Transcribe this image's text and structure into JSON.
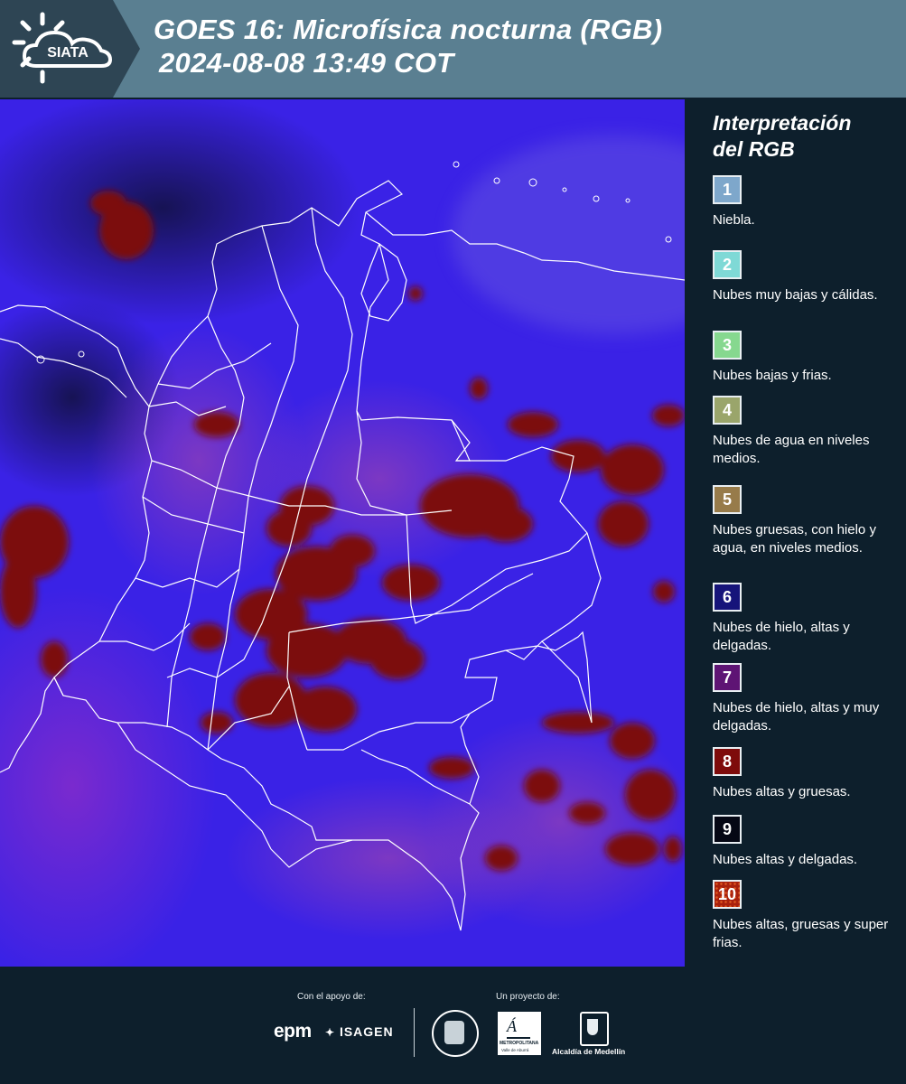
{
  "header": {
    "logo_text": "SIATA",
    "title_line1": "GOES 16: Microfísica nocturna (RGB)",
    "title_line2": "2024-08-08 13:49 COT"
  },
  "legend": {
    "title_line1": "Interpretación",
    "title_line2": "del RGB",
    "items": [
      {
        "number": "1",
        "text": "Niebla.",
        "color": "#7ea7cb"
      },
      {
        "number": "2",
        "text": "Nubes muy bajas y cálidas.",
        "color": "#7fd9d6"
      },
      {
        "number": "3",
        "text": "Nubes bajas y frias.",
        "color": "#86d88f"
      },
      {
        "number": "4",
        "text": "Nubes de agua en niveles medios.",
        "color": "#9aa56b"
      },
      {
        "number": "5",
        "text": "Nubes gruesas, con hielo y agua, en niveles medios.",
        "color": "#977b4a"
      },
      {
        "number": "6",
        "text": "Nubes de hielo, altas y delgadas.",
        "color": "#16147a"
      },
      {
        "number": "7",
        "text": "Nubes de hielo, altas y muy delgadas.",
        "color": "#5e1474"
      },
      {
        "number": "8",
        "text": "Nubes altas y gruesas.",
        "color": "#7e0b0b"
      },
      {
        "number": "9",
        "text": "Nubes altas y delgadas.",
        "color": "#050714"
      },
      {
        "number": "10",
        "text": "Nubes altas, gruesas y super frias.",
        "color": "#a8200c"
      }
    ]
  },
  "footer": {
    "support_label": "Con el apoyo de:",
    "project_label": "Un proyecto de:",
    "epm": "epm",
    "isagen": "ISAGEN",
    "metropolitana": "METROPOLITANA",
    "area_valle": "Valle de Aburrá",
    "alcaldia": "Alcaldía de Medellín"
  },
  "map": {
    "description_icon": "satellite-rgb-image",
    "colors": {
      "base": "#3b1fe0",
      "cloud": "#7a0a0a",
      "border": "#ffffff",
      "fog": "#5a2bd0"
    }
  }
}
